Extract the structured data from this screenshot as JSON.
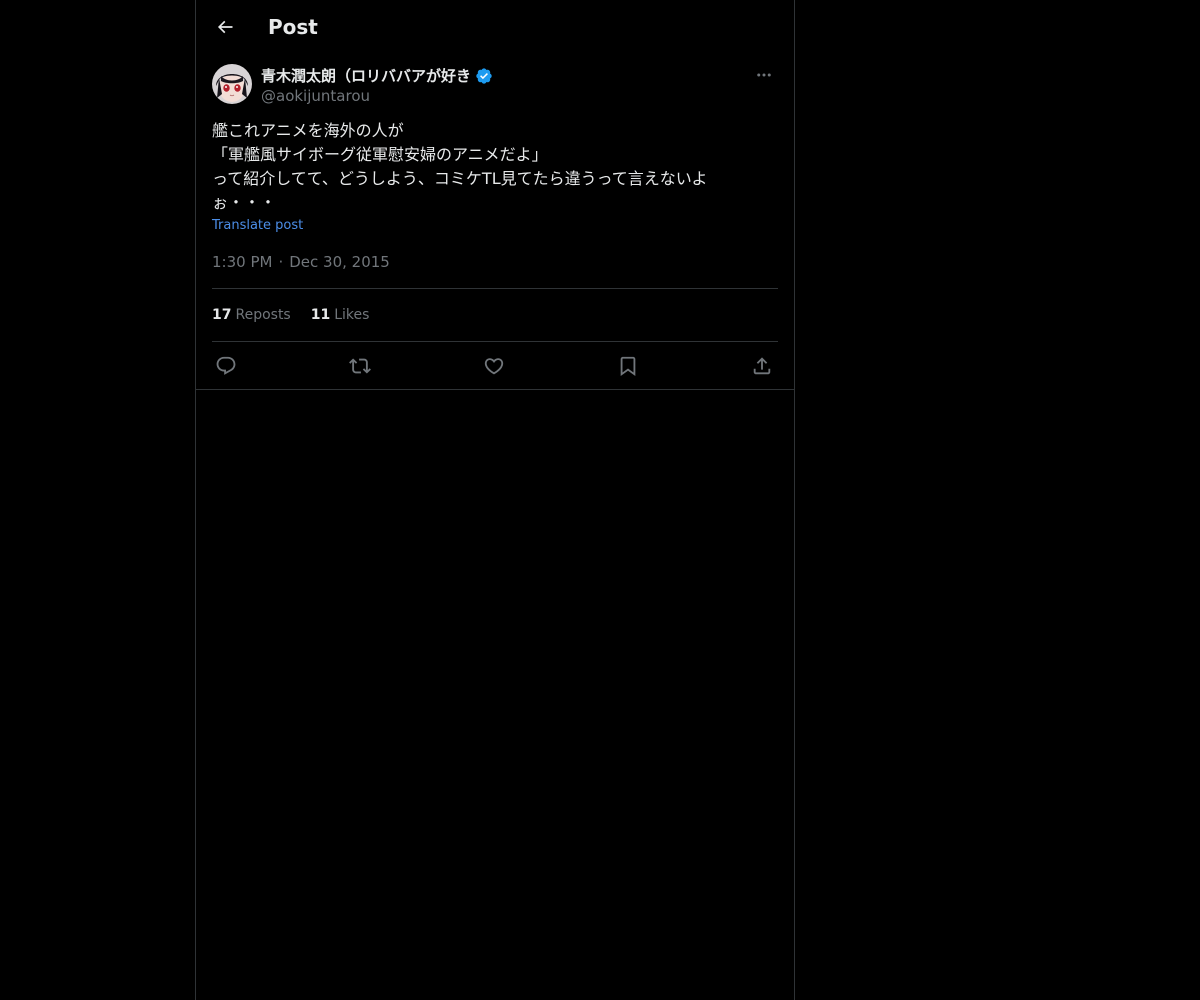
{
  "header": {
    "title": "Post",
    "back_icon": "arrow-left-icon"
  },
  "author": {
    "name": "青木潤太朗（ロリババアが好き",
    "handle": "@aokijuntarou",
    "verified": true,
    "verified_color": "#1d9bf0"
  },
  "post": {
    "text": "艦これアニメを海外の人が\n「軍艦風サイボーグ従軍慰安婦のアニメだよ」\nって紹介してて、どうしよう、コミケTL見てたら違うって言えないよぉ・・・",
    "translate_label": "Translate post",
    "time": "1:30 PM",
    "separator": "·",
    "date": "Dec 30, 2015"
  },
  "stats": {
    "reposts_count": "17",
    "reposts_label": "Reposts",
    "likes_count": "11",
    "likes_label": "Likes"
  },
  "actions": [
    {
      "name": "reply",
      "icon": "reply-icon"
    },
    {
      "name": "repost",
      "icon": "repost-icon"
    },
    {
      "name": "like",
      "icon": "heart-icon"
    },
    {
      "name": "bookmark",
      "icon": "bookmark-icon"
    },
    {
      "name": "share",
      "icon": "share-icon"
    }
  ],
  "colors": {
    "background": "#000000",
    "text": "#e7e9ea",
    "muted": "#71767b",
    "link": "#4c8ee8",
    "divider": "#2f3336"
  }
}
